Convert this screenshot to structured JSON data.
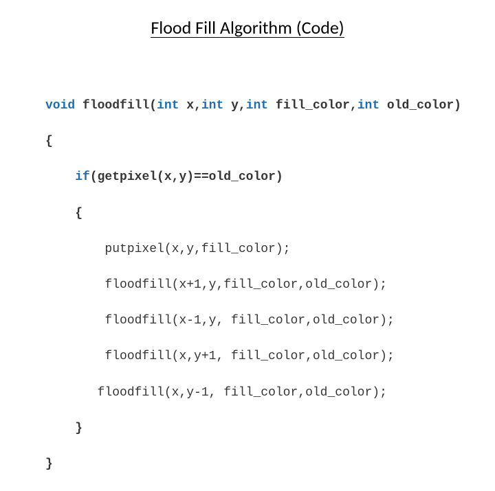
{
  "title": "Flood Fill Algorithm (Code)",
  "code": {
    "l1": {
      "kw1": "void",
      "fn": "floodfill(",
      "kw2": "int",
      "t1": " x,",
      "kw3": "int",
      "t2": " y,",
      "kw4": "int",
      "t3": " fill_color,",
      "kw5": "int",
      "t4": " old_color)"
    },
    "l2": "{",
    "l3": {
      "kw": "if",
      "rest": "(getpixel(x,y)==old_color)"
    },
    "l4": "{",
    "l5": "putpixel(x,y,fill_color);",
    "l6": "floodfill(x+1,y,fill_color,old_color);",
    "l7": "floodfill(x-1,y, fill_color,old_color);",
    "l8": "floodfill(x,y+1, fill_color,old_color);",
    "l9": "floodfill(x,y-1, fill_color,old_color);",
    "l10": "}",
    "l11": "}"
  }
}
